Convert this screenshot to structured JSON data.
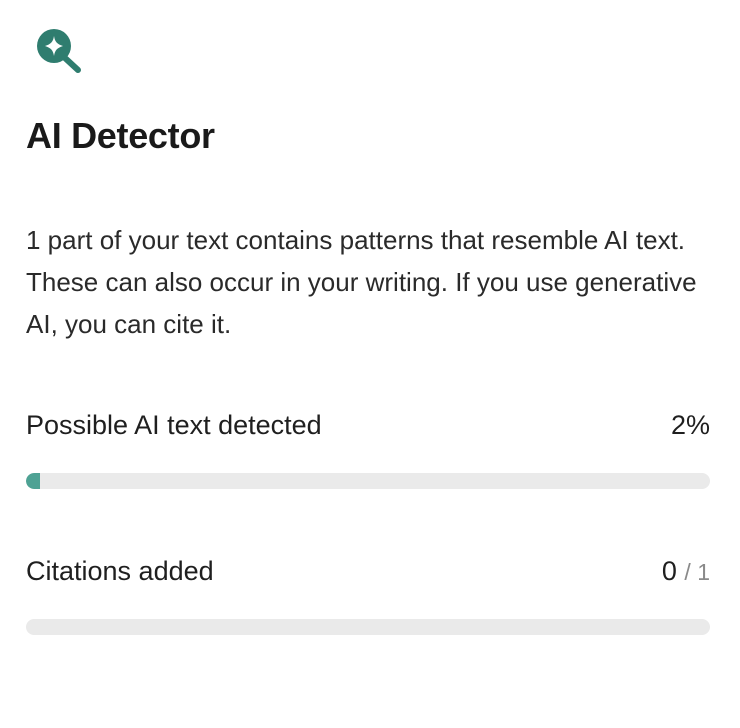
{
  "panel": {
    "icon": "magnifier-sparkle-icon",
    "title": "AI Detector",
    "description": "1 part of your text contains patterns that resemble AI text. These can also occur in your writing. If you use generative AI, you can cite it.",
    "accent_color": "#2f7d6f",
    "bar_fill_color": "#4ea294",
    "bar_track_color": "#eaeaea"
  },
  "metrics": {
    "ai_text": {
      "label": "Possible AI text detected",
      "value": "2%",
      "progress_fraction": 0.02
    },
    "citations": {
      "label": "Citations added",
      "value": "0",
      "denominator": "/ 1",
      "progress_fraction": 0
    }
  }
}
